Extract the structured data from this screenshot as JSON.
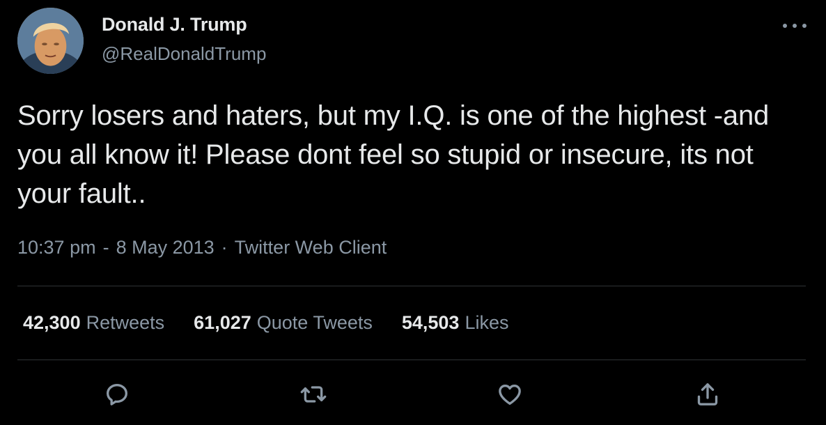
{
  "author": {
    "name": "Donald J. Trump",
    "handle": "@RealDonaldTrump",
    "avatar_icon": "profile-photo"
  },
  "tweet": {
    "text": "Sorry losers and haters, but my I.Q. is one of the highest -and you all know it! Please dont feel so stupid or insecure, its not your fault..",
    "time": "10:37 pm",
    "dash": "-",
    "date": "8 May 2013",
    "separator": "·",
    "client": "Twitter Web Client"
  },
  "stats": {
    "retweets": {
      "count": "42,300",
      "label": "Retweets"
    },
    "quote_tweets": {
      "count": "61,027",
      "label": "Quote Tweets"
    },
    "likes": {
      "count": "54,503",
      "label": "Likes"
    }
  },
  "actions": [
    {
      "icon": "reply-icon"
    },
    {
      "icon": "retweet-icon"
    },
    {
      "icon": "like-icon"
    },
    {
      "icon": "share-icon"
    }
  ],
  "menu": {
    "icon": "more-options-icon"
  },
  "colors": {
    "background": "#000000",
    "primary_text": "#e7e9ea",
    "secondary_text": "#8b98a5",
    "divider": "#2f3336"
  }
}
